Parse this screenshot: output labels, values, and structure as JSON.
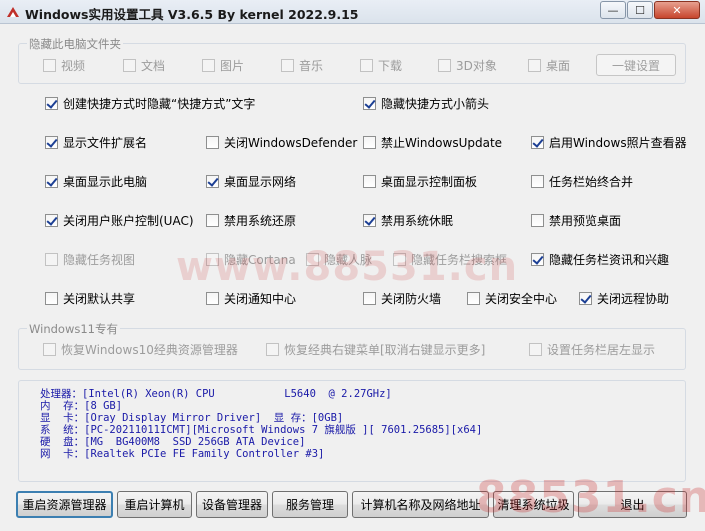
{
  "window": {
    "title": "Windows实用设置工具 V3.6.5 By kernel 2022.9.15",
    "minimize_glyph": "—",
    "maximize_glyph": "☐",
    "close_glyph": "✕",
    "icon": "app-logo-icon"
  },
  "hide_folders": {
    "title": "隐藏此电脑文件夹",
    "items": [
      "视频",
      "文档",
      "图片",
      "音乐",
      "下载",
      "3D对象",
      "桌面"
    ],
    "button": "一键设置"
  },
  "options": {
    "opt_hide_shortcut_text": "创建快捷方式时隐藏“快捷方式”文字",
    "opt_hide_shortcut_arrow": "隐藏快捷方式小箭头",
    "opt_show_ext": "显示文件扩展名",
    "opt_close_defender": "关闭WindowsDefender",
    "opt_disable_update": "禁止WindowsUpdate",
    "opt_photo_viewer": "启用Windows照片查看器",
    "opt_desktop_pc": "桌面显示此电脑",
    "opt_desktop_network": "桌面显示网络",
    "opt_desktop_control": "桌面显示控制面板",
    "opt_taskbar_combine": "任务栏始终合并",
    "opt_uac": "关闭用户账户控制(UAC)",
    "opt_restore": "禁用系统还原",
    "opt_sleep": "禁用系统休眠",
    "opt_preview_desktop": "禁用预览桌面",
    "opt_task_view": "隐藏任务视图",
    "opt_cortana": "隐藏Cortana",
    "opt_people": "隐藏人脉",
    "opt_search_box": "隐藏任务栏搜索框",
    "opt_news": "隐藏任务栏资讯和兴趣",
    "opt_default_share": "关闭默认共享",
    "opt_notify": "关闭通知中心",
    "opt_firewall": "关闭防火墙",
    "opt_security_center": "关闭安全中心",
    "opt_remote": "关闭远程协助"
  },
  "win11": {
    "title": "Windows11专有",
    "opt_classic_explorer": "恢复Windows10经典资源管理器",
    "opt_classic_menu": "恢复经典右键菜单[取消右键显示更多]",
    "opt_taskbar_left": "设置任务栏居左显示"
  },
  "sysinfo": {
    "cpu": "处理器：[Intel(R) Xeon(R) CPU           L5640  @ 2.27GHz]",
    "mem": "内  存：[8 GB]",
    "gpu": "显  卡：[Oray Display Mirror Driver]  显 存：[0GB]",
    "os": "系  统：[PC-20211011ICMT][Microsoft Windows 7 旗舰版 ][ 7601.25685][x64]",
    "disk": "硬  盘：[MG  BG400M8  SSD 256GB ATA Device]",
    "nic": "网  卡：[Realtek PCIe FE Family Controller #3]"
  },
  "buttons": {
    "restart_explorer": "重启资源管理器",
    "restart_pc": "重启计算机",
    "device_manager": "设备管理器",
    "services": "服务管理",
    "pc_name_network": "计算机名称及网络地址",
    "clean_junk": "清理系统垃圾",
    "exit": "退出"
  },
  "watermarks": {
    "center": "www.88531.cn",
    "corner": "88531.cn"
  }
}
